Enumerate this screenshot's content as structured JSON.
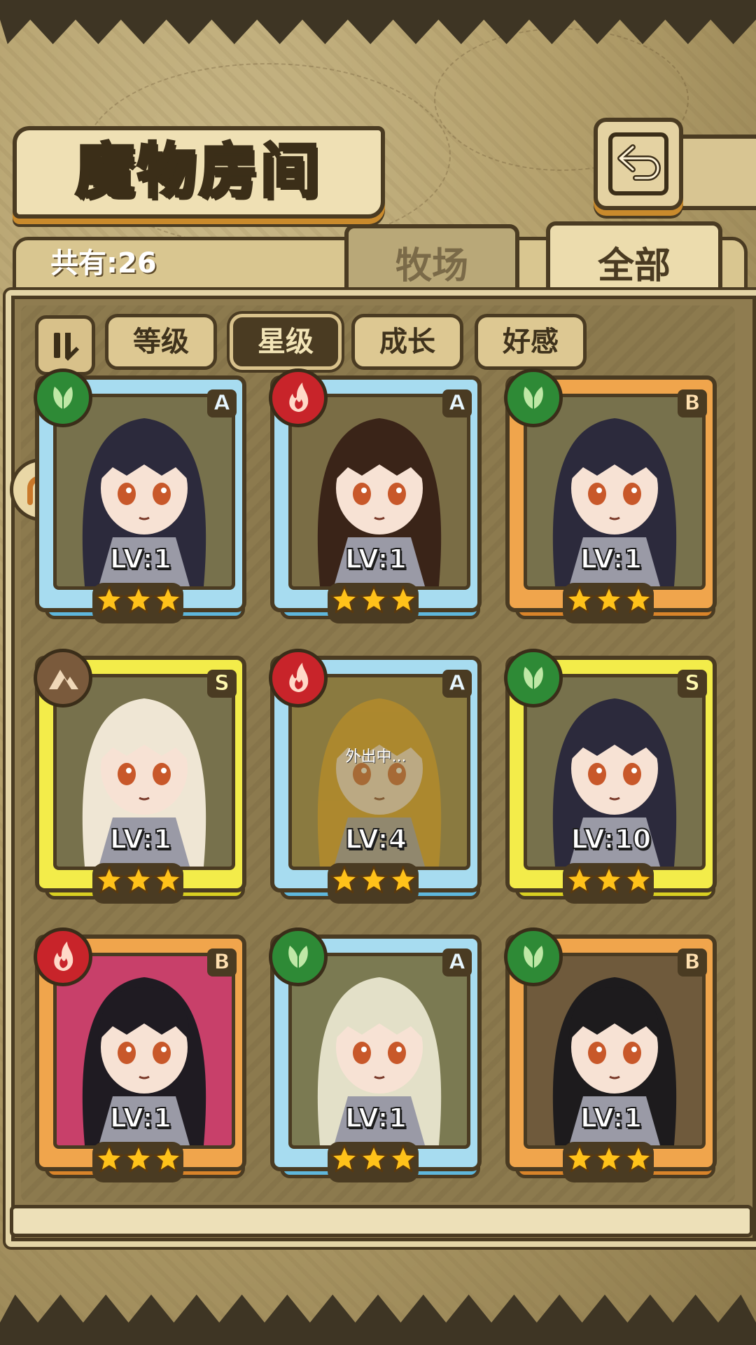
{
  "header": {
    "title": "魔物房间"
  },
  "summary": {
    "count_label": "共有:26"
  },
  "tabs": [
    {
      "label": "牧场",
      "active": false
    },
    {
      "label": "全部",
      "active": true
    }
  ],
  "sort_buttons": [
    {
      "label": "等级",
      "active": false
    },
    {
      "label": "星级",
      "active": true
    },
    {
      "label": "成长",
      "active": false
    },
    {
      "label": "好感",
      "active": false
    }
  ],
  "monsters": [
    {
      "level": "LV:1",
      "rank": "A",
      "element": "leaf-icon",
      "frame": "blue",
      "stars": 3,
      "status": ""
    },
    {
      "level": "LV:1",
      "rank": "A",
      "element": "fire-icon",
      "frame": "blue",
      "stars": 3,
      "status": ""
    },
    {
      "level": "LV:1",
      "rank": "B",
      "element": "leaf-icon",
      "frame": "orange",
      "stars": 3,
      "status": ""
    },
    {
      "level": "LV:1",
      "rank": "S",
      "element": "earth-icon",
      "frame": "yellow",
      "stars": 3,
      "status": ""
    },
    {
      "level": "LV:4",
      "rank": "A",
      "element": "fire-icon",
      "frame": "blue",
      "stars": 3,
      "status": "外出中..."
    },
    {
      "level": "LV:10",
      "rank": "S",
      "element": "leaf-icon",
      "frame": "yellow",
      "stars": 3,
      "status": ""
    },
    {
      "level": "LV:1",
      "rank": "B",
      "element": "fire-icon",
      "frame": "orange",
      "stars": 3,
      "status": ""
    },
    {
      "level": "LV:1",
      "rank": "A",
      "element": "leaf-icon",
      "frame": "blue",
      "stars": 3,
      "status": ""
    },
    {
      "level": "LV:1",
      "rank": "B",
      "element": "leaf-icon",
      "frame": "orange",
      "stars": 3,
      "status": ""
    }
  ],
  "colors": {
    "frame_blue": "#a7dcf0",
    "frame_orange": "#f0a54c",
    "frame_yellow": "#f3ec4a",
    "element_leaf": "#2e8a36",
    "element_fire": "#c8242a",
    "element_earth": "#7a5a3c",
    "star": "#ffc21a"
  }
}
